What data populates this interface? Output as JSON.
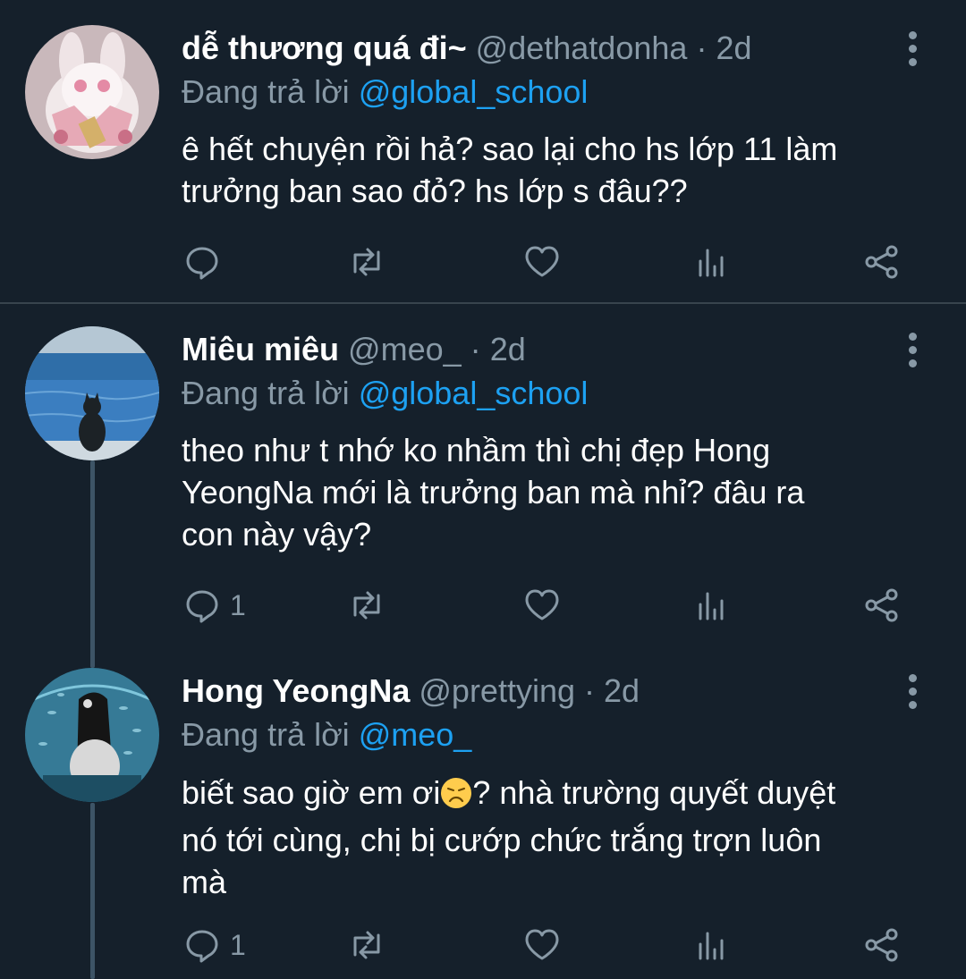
{
  "tweets": [
    {
      "display_name": "dễ thương quá đi~",
      "handle": "@dethatdonha",
      "separator": "·",
      "time": "2d",
      "replying_label": "Đang trả lời",
      "replying_to": "@global_school",
      "text_lines": [
        "ê hết chuyện rồi hả? sao lại cho hs lớp 11 làm",
        "trưởng ban sao đỏ? hs lớp s đâu??"
      ],
      "reply_count": "",
      "avatar_icon": "plush-bunny-avatar"
    },
    {
      "display_name": "Miêu miêu",
      "handle": "@meo_",
      "separator": "·",
      "time": "2d",
      "replying_label": "Đang trả lời",
      "replying_to": "@global_school",
      "text_lines": [
        "theo như t nhớ ko nhầm thì chị đẹp Hong",
        "YeongNa mới là trưởng ban mà nhỉ? đâu ra",
        "con này vậy?"
      ],
      "reply_count": "1",
      "avatar_icon": "cat-at-sea-avatar"
    },
    {
      "display_name": "Hong YeongNa",
      "handle": "@prettying",
      "separator": "·",
      "time": "2d",
      "replying_label": "Đang trả lời",
      "replying_to": "@meo_",
      "text_lines": [
        "biết sao giờ em ơi",
        "? nhà trường quyết duyệt",
        "nó tới cùng, chị bị cướp chức trắng trợn luôn",
        "mà"
      ],
      "emoji": "disappointed-face",
      "reply_count": "1",
      "avatar_icon": "girl-at-aquarium-avatar"
    }
  ],
  "colors": {
    "background": "#15202b",
    "text_primary": "#ffffff",
    "text_secondary": "#8899a6",
    "link": "#1da1f2",
    "divider": "#38444d"
  }
}
